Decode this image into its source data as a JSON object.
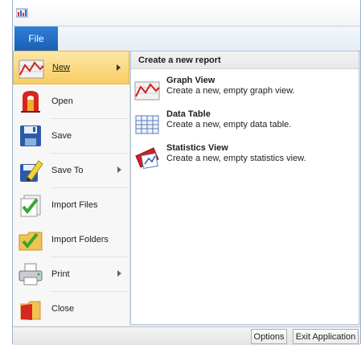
{
  "titlebar": {
    "app_icon": "app-icon"
  },
  "tabs": {
    "file_label": "File"
  },
  "menu": {
    "items": [
      {
        "label": "New",
        "icon": "new-report-icon",
        "has_submenu": true,
        "active": true
      },
      {
        "label": "Open",
        "icon": "open-icon",
        "has_submenu": false
      },
      {
        "label": "Save",
        "icon": "save-icon",
        "has_submenu": false
      },
      {
        "label": "Save To",
        "icon": "save-to-icon",
        "has_submenu": true
      },
      {
        "label": "Import Files",
        "icon": "import-files-icon",
        "has_submenu": false
      },
      {
        "label": "Import Folders",
        "icon": "import-folders-icon",
        "has_submenu": false
      },
      {
        "label": "Print",
        "icon": "print-icon",
        "has_submenu": true
      },
      {
        "label": "Close",
        "icon": "close-icon",
        "has_submenu": false
      }
    ]
  },
  "panel": {
    "header": "Create a new report",
    "options": [
      {
        "title": "Graph View",
        "description": "Create a new, empty graph view.",
        "icon": "graph-view-icon"
      },
      {
        "title": "Data Table",
        "description": "Create a new, empty data table.",
        "icon": "data-table-icon"
      },
      {
        "title": "Statistics View",
        "description": "Create a new, empty statistics view.",
        "icon": "statistics-view-icon"
      }
    ]
  },
  "status": {
    "options_label": "Options",
    "exit_label": "Exit Application"
  },
  "colors": {
    "accent": "#1a5fb4",
    "highlight": "#f8cd62"
  }
}
